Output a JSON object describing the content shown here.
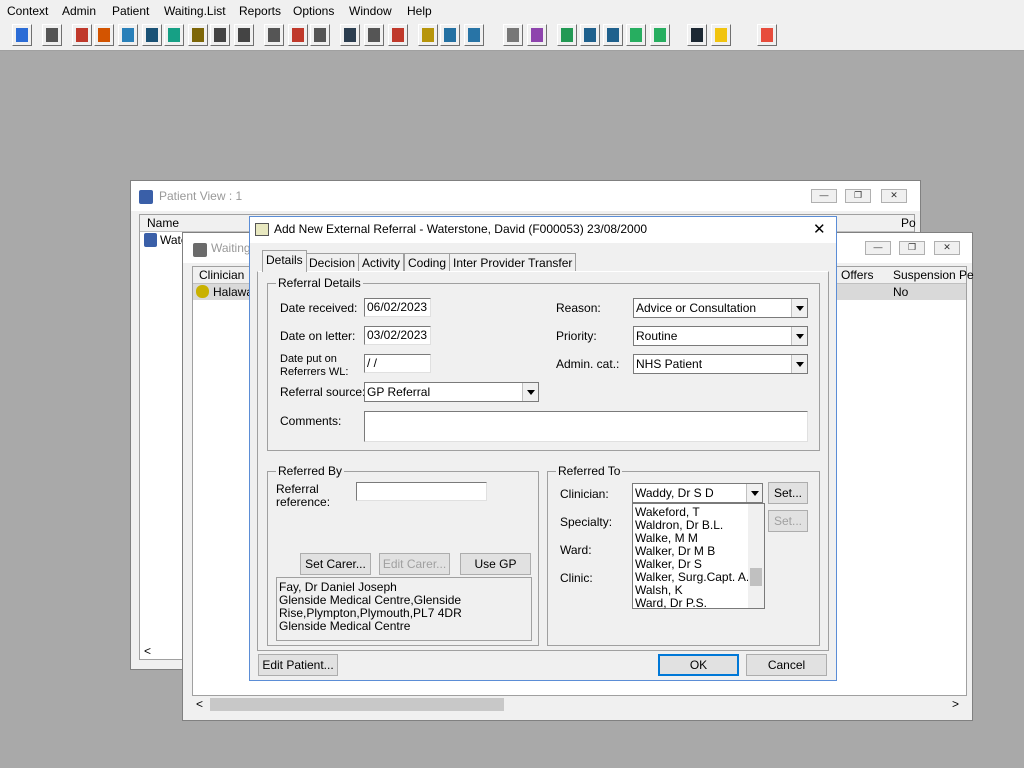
{
  "menu": [
    "Context",
    "Admin",
    "Patient",
    "Waiting.List",
    "Reports",
    "Options",
    "Window",
    "Help"
  ],
  "toolbar_icons": [
    "user-icon",
    "print-icon",
    "book-icon",
    "edit-icon",
    "find-icon",
    "m-icon",
    "person-icon",
    "form-icon",
    "camera-icon",
    "camera2-icon",
    "search-doc-icon",
    "clock-icon",
    "screen-icon",
    "photo-icon",
    "note-icon",
    "compass-icon",
    "document-icon",
    "bed-icon",
    "ambulance-icon",
    "page-icon",
    "chart-icon",
    "globe-icon",
    "check-form-icon",
    "check-form2-icon",
    "green-arrow-icon",
    "green-arrow2-icon",
    "transfer-icon",
    "warning-icon",
    "exit-icon"
  ],
  "patient_view": {
    "title": "Patient View : 1",
    "col_name": "Name",
    "col_po": "Po",
    "row_name": "Wate"
  },
  "waiting": {
    "title": "Waiting",
    "col_clinician": "Clinician",
    "col_offers": "Offers",
    "col_suspension": "Suspension Pe",
    "row_name": "Halawa",
    "row_suspension": "No"
  },
  "dialog": {
    "title": "Add New External Referral - Waterstone, David (F000053) 23/08/2000",
    "close": "✕",
    "tabs": [
      "Details",
      "Decision",
      "Activity",
      "Coding",
      "Inter Provider Transfer"
    ],
    "referral_details": {
      "group_label": "Referral Details",
      "date_received_label": "Date received:",
      "date_received": "06/02/2023",
      "date_on_letter_label": "Date on letter:",
      "date_on_letter": "03/02/2023",
      "date_put_label_1": "Date put on",
      "date_put_label_2": "Referrers WL:",
      "date_put": " /  /",
      "referral_source_label": "Referral source:",
      "referral_source": "GP Referral",
      "reason_label": "Reason:",
      "reason": "Advice or Consultation",
      "priority_label": "Priority:",
      "priority": "Routine",
      "admin_cat_label": "Admin. cat.:",
      "admin_cat": "NHS Patient",
      "comments_label": "Comments:",
      "comments": ""
    },
    "referred_by": {
      "group_label": "Referred By",
      "referral_reference_label_1": "Referral",
      "referral_reference_label_2": "reference:",
      "referral_reference": "",
      "set_carer": "Set Carer...",
      "edit_carer": "Edit Carer...",
      "use_gp": "Use GP",
      "address": [
        "Fay, Dr Daniel Joseph",
        "Glenside Medical Centre,Glenside",
        "Rise,Plympton,Plymouth,PL7 4DR",
        "Glenside Medical Centre"
      ]
    },
    "referred_to": {
      "group_label": "Referred To",
      "clinician_label": "Clinician:",
      "clinician": "Waddy, Dr S D",
      "specialty_label": "Specialty:",
      "ward_label": "Ward:",
      "clinic_label": "Clinic:",
      "set": "Set...",
      "set2": "Set...",
      "clinician_options": [
        "Wakeford, T",
        "Waldron, Dr B.L.",
        "Walke, M M",
        "Walker, Dr M B",
        "Walker, Dr S",
        "Walker, Surg.Capt. A.J.",
        "Walsh, K",
        "Ward, Dr P.S."
      ]
    },
    "edit_patient": "Edit Patient...",
    "ok": "OK",
    "cancel": "Cancel"
  },
  "colors": {
    "desktop": "#a9a9a9",
    "window_bg": "#f0f0f0",
    "dialog_border": "#5b8dd6"
  }
}
